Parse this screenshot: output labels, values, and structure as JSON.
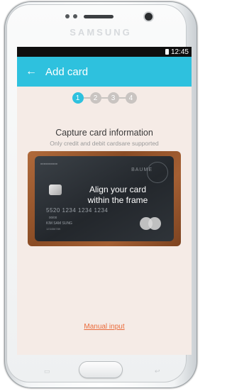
{
  "device": {
    "brand": "SAMSUNG"
  },
  "status_bar": {
    "time": "12:45"
  },
  "app_bar": {
    "back_icon": "←",
    "title": "Add card"
  },
  "steps": [
    "1",
    "2",
    "3",
    "4"
  ],
  "capture": {
    "title": "Capture card information",
    "subtitle": "Only credit and debit cardsare supported"
  },
  "card_preview": {
    "brand_text": "BAUME",
    "instruction_line1": "Align your card",
    "instruction_line2": "within the frame",
    "number": "5520  1234  1234  1234",
    "expiry": "00/00",
    "holder": "KIM SAM SUNG",
    "account": "123456789"
  },
  "manual_input_label": "Manual input",
  "colors": {
    "accent": "#2ec1de",
    "link": "#ea6b3b",
    "screen_bg": "#f5ebe6"
  }
}
